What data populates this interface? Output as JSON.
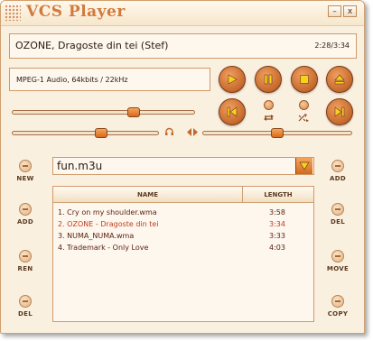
{
  "app": {
    "title": "VCS Player"
  },
  "window_controls": {
    "minimize": "–",
    "close": "x"
  },
  "now_playing": {
    "track": "OZONE, Dragoste din tei (Stef)",
    "time": "2:28/3:34"
  },
  "stream_info": "MPEG-1 Audio, 64kbits / 22kHz",
  "sliders": {
    "seek_position": 0.68,
    "volume": 0.62,
    "balance": 0.5
  },
  "playlist": {
    "file": "fun.m3u",
    "columns": {
      "name": "NAME",
      "length": "LENGTH"
    },
    "items": [
      {
        "name": "1. Cry on my shoulder.wma",
        "length": "3:58",
        "selected": false
      },
      {
        "name": "2. OZONE - Dragoste din tei",
        "length": "3:34",
        "selected": true
      },
      {
        "name": "3. NUMA_NUMA.wma",
        "length": "3:33",
        "selected": false
      },
      {
        "name": "4. Trademark - Only Love",
        "length": "4:03",
        "selected": false
      }
    ]
  },
  "left_buttons": {
    "new": "NEW",
    "add": "ADD",
    "ren": "REN",
    "del": "DEL"
  },
  "right_buttons": {
    "add": "ADD",
    "del": "DEL",
    "move": "MOVE",
    "copy": "COPY"
  },
  "icons": {
    "play": "play-icon",
    "pause": "pause-icon",
    "stop": "stop-icon",
    "eject": "eject-icon",
    "previous": "previous-icon",
    "next": "next-icon",
    "repeat": "repeat-icon",
    "shuffle": "shuffle-icon",
    "headphones": "headphones-icon",
    "balance": "balance-icon",
    "dropdown": "dropdown-icon"
  },
  "colors": {
    "accent": "#d17a3c",
    "button": "#c5682c",
    "glyph": "#f7d020",
    "selected_text": "#c43a1a"
  }
}
